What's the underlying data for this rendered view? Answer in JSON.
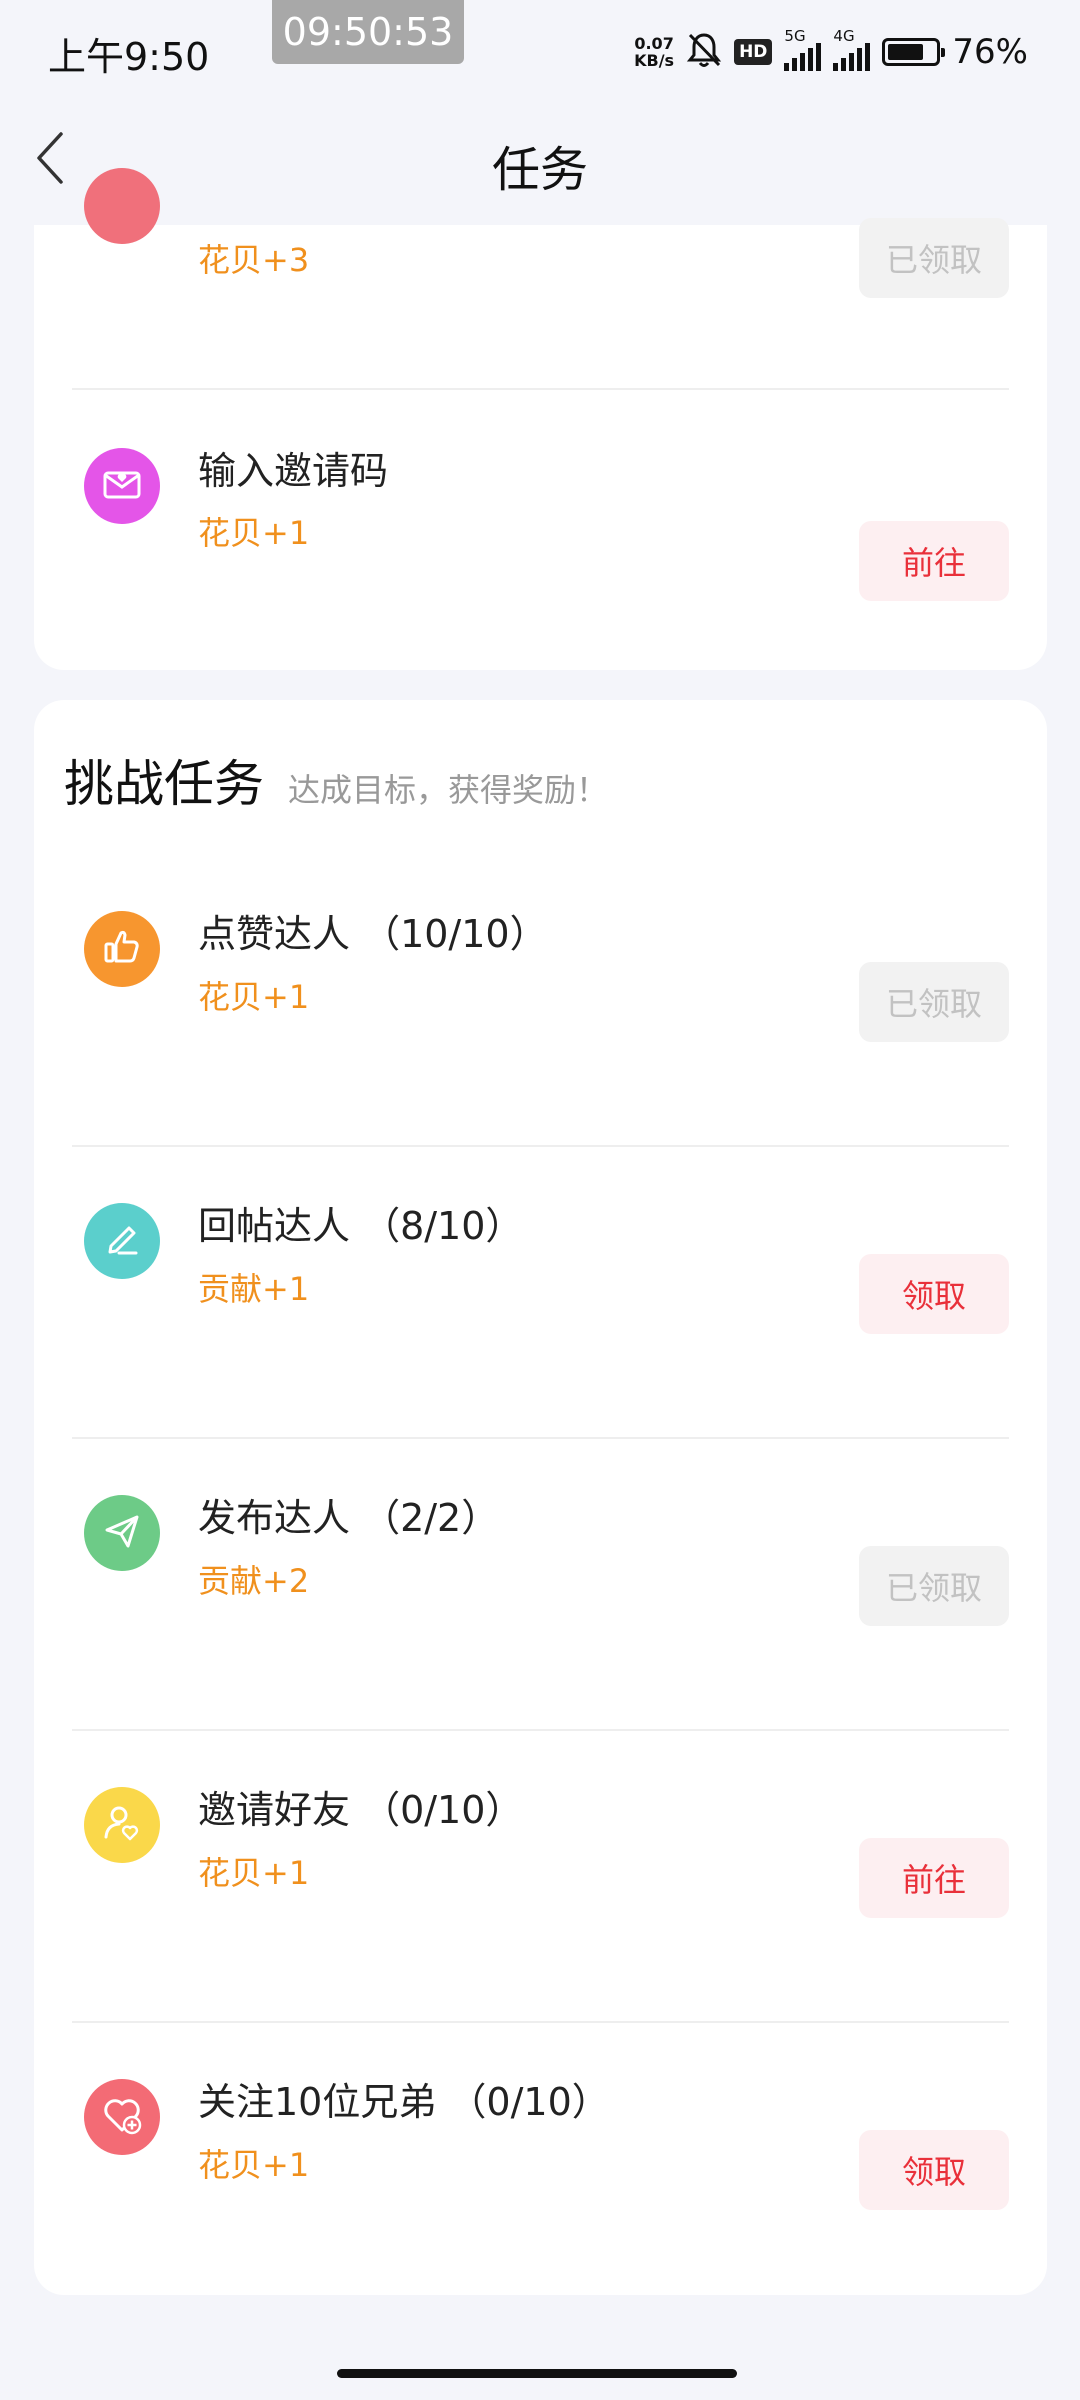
{
  "status_bar": {
    "time": "上午9:50",
    "screen_clock": "09:50:53",
    "net_speed_value": "0.07",
    "net_speed_unit": "KB/s",
    "hd_label": "HD",
    "sim1_type": "5G",
    "sim2_type": "4G",
    "battery_percent": "76%",
    "battery_level": 0.76
  },
  "header": {
    "title": "任务"
  },
  "section_one": {
    "tasks": [
      {
        "reward": "花贝+3",
        "button": "已领取",
        "icon": "heart-icon",
        "color": "#f0707b"
      },
      {
        "name": "输入邀请码",
        "reward": "花贝+1",
        "button": "前往",
        "icon": "envelope-heart-icon",
        "color": "#e455e8"
      }
    ]
  },
  "challenge": {
    "title": "挑战任务",
    "subtitle": "达成目标，获得奖励！",
    "tasks": [
      {
        "name": "点赞达人 （10/10）",
        "reward": "花贝+1",
        "button": "已领取",
        "icon": "thumbs-up-icon",
        "color": "#f7962f"
      },
      {
        "name": "回帖达人 （8/10）",
        "reward": "贡献+1",
        "button": "领取",
        "icon": "pen-icon",
        "color": "#5bcfcc"
      },
      {
        "name": "发布达人 （2/2）",
        "reward": "贡献+2",
        "button": "已领取",
        "icon": "paper-plane-icon",
        "color": "#6dcb87"
      },
      {
        "name": "邀请好友 （0/10）",
        "reward": "花贝+1",
        "button": "前往",
        "icon": "user-heart-icon",
        "color": "#fad84a"
      },
      {
        "name": "关注10位兄弟 （0/10）",
        "reward": "花贝+1",
        "button": "领取",
        "icon": "heart-plus-icon",
        "color": "#f36b75"
      }
    ]
  },
  "colors": {
    "reward_text": "#f0901d",
    "active_button_text": "#e9303a",
    "active_button_bg": "#fdeff1",
    "claimed_button_text": "#c2c2c2",
    "claimed_button_bg": "#f2f2f2",
    "page_bg": "#f4f5fa"
  }
}
